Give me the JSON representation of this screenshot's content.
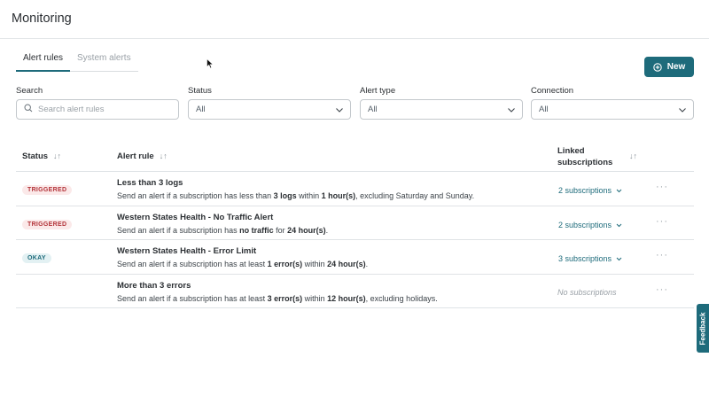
{
  "page": {
    "title": "Monitoring"
  },
  "tabs": [
    {
      "label": "Alert rules",
      "active": true
    },
    {
      "label": "System alerts",
      "active": false
    }
  ],
  "new_button": {
    "label": "New",
    "icon": "plus-circle-icon"
  },
  "filters": {
    "search": {
      "label": "Search",
      "placeholder": "Search alert rules",
      "value": ""
    },
    "status": {
      "label": "Status",
      "value": "All"
    },
    "alert_type": {
      "label": "Alert type",
      "value": "All"
    },
    "connection": {
      "label": "Connection",
      "value": "All"
    }
  },
  "table": {
    "columns": {
      "status": "Status",
      "alert_rule": "Alert rule",
      "linked_line1": "Linked",
      "linked_line2": "subscriptions"
    },
    "rows": [
      {
        "status": "TRIGGERED",
        "name": "Less than 3 logs",
        "desc": [
          {
            "t": "Send an alert if a subscription has less than ",
            "b": false
          },
          {
            "t": "3 logs",
            "b": true
          },
          {
            "t": " within ",
            "b": false
          },
          {
            "t": "1 hour(s)",
            "b": true
          },
          {
            "t": ", excluding Saturday and Sunday.",
            "b": false
          }
        ],
        "subscriptions": "2 subscriptions"
      },
      {
        "status": "TRIGGERED",
        "name": "Western States Health - No Traffic Alert",
        "desc": [
          {
            "t": "Send an alert if a subscription has ",
            "b": false
          },
          {
            "t": "no traffic",
            "b": true
          },
          {
            "t": " for ",
            "b": false
          },
          {
            "t": "24 hour(s)",
            "b": true
          },
          {
            "t": ".",
            "b": false
          }
        ],
        "subscriptions": "2 subscriptions"
      },
      {
        "status": "OKAY",
        "name": "Western States Health - Error Limit",
        "desc": [
          {
            "t": "Send an alert if a subscription has at least ",
            "b": false
          },
          {
            "t": "1 error(s)",
            "b": true
          },
          {
            "t": " within ",
            "b": false
          },
          {
            "t": "24 hour(s)",
            "b": true
          },
          {
            "t": ".",
            "b": false
          }
        ],
        "subscriptions": "3 subscriptions"
      },
      {
        "status": "",
        "name": "More than 3 errors",
        "desc": [
          {
            "t": "Send an alert if a subscription has at least ",
            "b": false
          },
          {
            "t": "3 error(s)",
            "b": true
          },
          {
            "t": " within ",
            "b": false
          },
          {
            "t": "12 hour(s)",
            "b": true
          },
          {
            "t": ", excluding holidays.",
            "b": false
          }
        ],
        "subscriptions": "",
        "no_subscriptions_label": "No subscriptions"
      }
    ]
  },
  "feedback": {
    "label": "Feedback"
  },
  "colors": {
    "accent": "#1e6b7b",
    "triggered_bg": "#fbe9e9",
    "triggered_fg": "#b3343a",
    "okay_bg": "#e3f1f3"
  }
}
